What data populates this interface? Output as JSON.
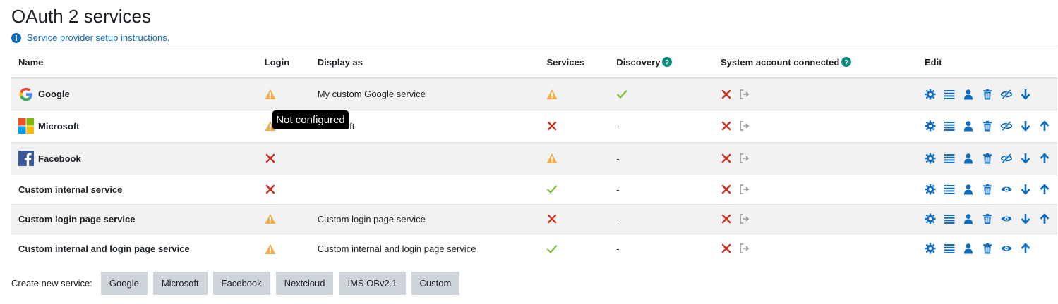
{
  "page": {
    "title": "OAuth 2 services",
    "instructions_link": "Service provider setup instructions."
  },
  "table": {
    "headers": {
      "name": "Name",
      "login": "Login",
      "display_as": "Display as",
      "services": "Services",
      "discovery": "Discovery",
      "system_account": "System account connected",
      "edit": "Edit"
    },
    "rows": [
      {
        "name": "Google",
        "logo": "google-logo",
        "login": "warning",
        "display_as": "My custom Google service",
        "services": "warning",
        "discovery": "check",
        "discovery_text": "",
        "actions": [
          "gear",
          "list",
          "user",
          "trash",
          "eye-slash",
          "arrow-down"
        ]
      },
      {
        "name": "Microsoft",
        "logo": "microsoft-logo",
        "login": "warning",
        "display_as": "Microsoft",
        "services": "cross",
        "discovery": "",
        "discovery_text": "-",
        "actions": [
          "gear",
          "list",
          "user",
          "trash",
          "eye-slash",
          "arrow-down",
          "arrow-up"
        ]
      },
      {
        "name": "Facebook",
        "logo": "facebook-logo",
        "login": "cross",
        "display_as": "",
        "services": "warning",
        "discovery": "",
        "discovery_text": "-",
        "actions": [
          "gear",
          "list",
          "user",
          "trash",
          "eye-slash",
          "arrow-down",
          "arrow-up"
        ]
      },
      {
        "name": "Custom internal service",
        "logo": "",
        "login": "cross",
        "display_as": "",
        "services": "check",
        "discovery": "",
        "discovery_text": "-",
        "actions": [
          "gear",
          "list",
          "user",
          "trash",
          "eye",
          "arrow-down",
          "arrow-up"
        ]
      },
      {
        "name": "Custom login page service",
        "logo": "",
        "login": "warning",
        "display_as": "Custom login page service",
        "services": "cross",
        "discovery": "",
        "discovery_text": "-",
        "actions": [
          "gear",
          "list",
          "user",
          "trash",
          "eye",
          "arrow-down",
          "arrow-up"
        ]
      },
      {
        "name": "Custom internal and login page service",
        "logo": "",
        "login": "warning",
        "display_as": "Custom internal and login page service",
        "services": "check",
        "discovery": "",
        "discovery_text": "-",
        "actions": [
          "gear",
          "list",
          "user",
          "trash",
          "eye",
          "arrow-up"
        ]
      }
    ]
  },
  "tooltip": {
    "text": "Not configured"
  },
  "create": {
    "label": "Create new service:",
    "buttons": [
      "Google",
      "Microsoft",
      "Facebook",
      "Nextcloud",
      "IMS OBv2.1",
      "Custom"
    ]
  },
  "colors": {
    "link": "#0f6cbf",
    "warning": "#f0ad4e",
    "danger": "#ca3120",
    "success": "#7bbd2e",
    "button_bg": "#ced4da"
  }
}
